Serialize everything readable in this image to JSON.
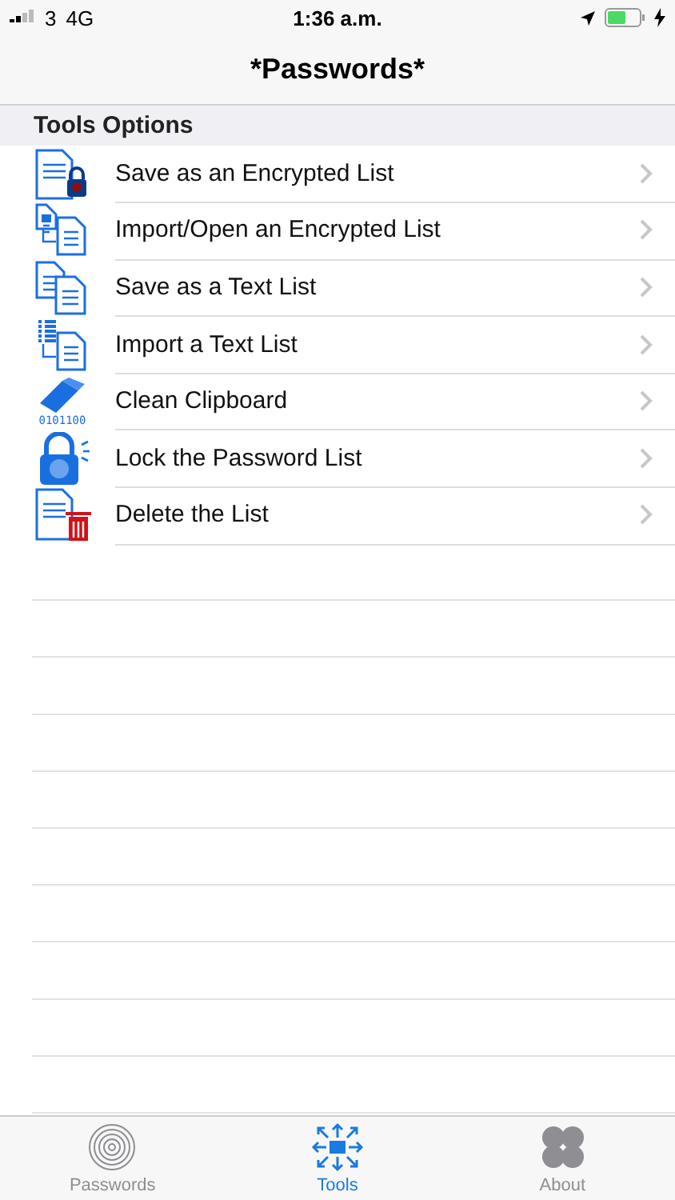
{
  "status_bar": {
    "carrier": "3",
    "network": "4G",
    "time": "1:36 a.m."
  },
  "nav": {
    "title": "*Passwords*"
  },
  "section": {
    "title": "Tools Options"
  },
  "items": [
    {
      "kind": "encrypt",
      "label": "Save as an Encrypted List"
    },
    {
      "kind": "import-encrypted",
      "label": "Import/Open an Encrypted List"
    },
    {
      "kind": "copy",
      "label": "Save as a Text List"
    },
    {
      "kind": "import-text",
      "label": "Import a Text List"
    },
    {
      "kind": "eraser",
      "label": "Clean Clipboard",
      "icon_text": "0101100"
    },
    {
      "kind": "lock",
      "label": "Lock the Password List"
    },
    {
      "kind": "delete",
      "label": "Delete the List"
    }
  ],
  "tabs": [
    {
      "kind": "fingerprint",
      "label": "Passwords",
      "selected": false
    },
    {
      "kind": "tools",
      "label": "Tools",
      "selected": true
    },
    {
      "kind": "clover",
      "label": "About",
      "selected": false
    }
  ]
}
